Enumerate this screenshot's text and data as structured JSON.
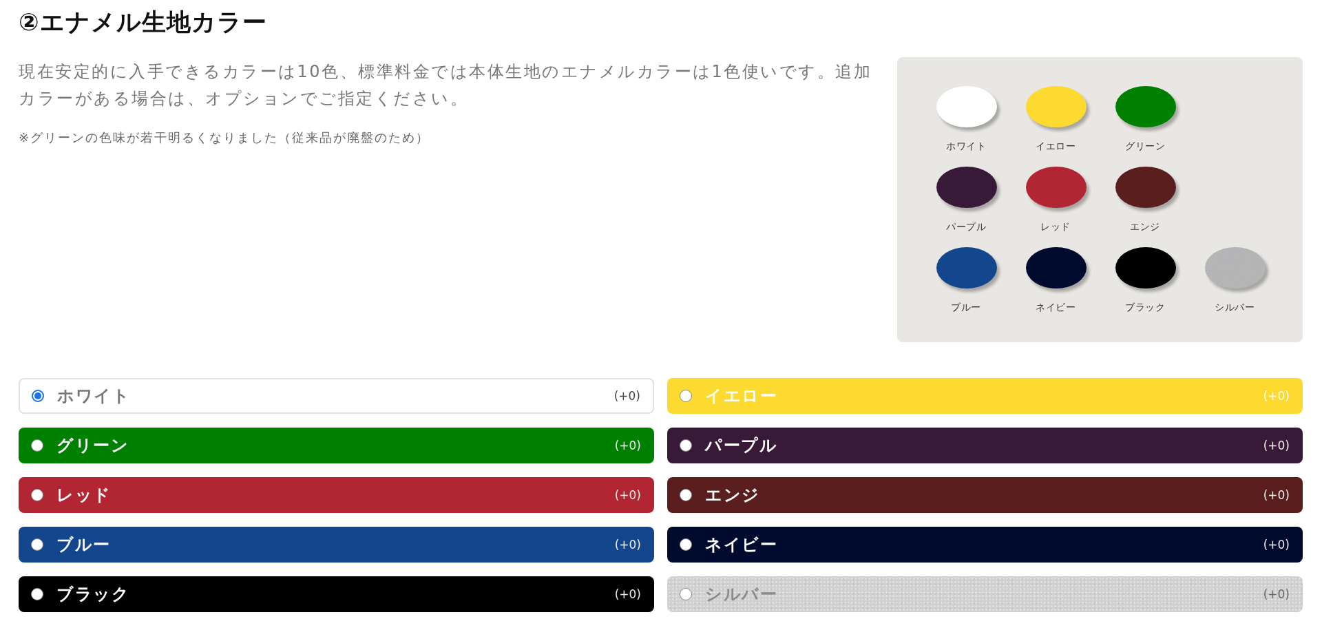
{
  "section": {
    "title": "②エナメル生地カラー",
    "description": "現在安定的に入手できるカラーは10色、標準料金では本体生地のエナメルカラーは1色使いです。追加カラーがある場合は、オプションでご指定ください。",
    "note": "※グリーンの色味が若干明るくなりました（従来品が廃盤のため）"
  },
  "swatch_panel": {
    "rows": [
      {
        "swatches": [
          {
            "label": "ホワイト",
            "color": "#ffffff",
            "kind": "solid"
          },
          {
            "label": "イエロー",
            "color": "#fdda2f",
            "kind": "solid"
          },
          {
            "label": "グリーン",
            "color": "#008000",
            "kind": "solid"
          }
        ]
      },
      {
        "swatches": [
          {
            "label": "パープル",
            "color": "#381a38",
            "kind": "solid"
          },
          {
            "label": "レッド",
            "color": "#b12632",
            "kind": "solid"
          },
          {
            "label": "エンジ",
            "color": "#5a1e1e",
            "kind": "solid"
          }
        ]
      },
      {
        "swatches": [
          {
            "label": "ブルー",
            "color": "#13468c",
            "kind": "solid"
          },
          {
            "label": "ネイビー",
            "color": "#000a2e",
            "kind": "solid"
          },
          {
            "label": "ブラック",
            "color": "#000000",
            "kind": "solid"
          },
          {
            "label": "シルバー",
            "color": "#b4b4b6",
            "kind": "metallic"
          }
        ]
      }
    ]
  },
  "options": [
    {
      "label": "ホワイト",
      "price": "(+0)",
      "selected": true,
      "color": "#ffffff",
      "kind": "plain"
    },
    {
      "label": "イエロー",
      "price": "(+0)",
      "selected": false,
      "color": "#fdda2f",
      "kind": "solid"
    },
    {
      "label": "グリーン",
      "price": "(+0)",
      "selected": false,
      "color": "#008000",
      "kind": "solid"
    },
    {
      "label": "パープル",
      "price": "(+0)",
      "selected": false,
      "color": "#381a38",
      "kind": "solid"
    },
    {
      "label": "レッド",
      "price": "(+0)",
      "selected": false,
      "color": "#b12632",
      "kind": "solid"
    },
    {
      "label": "エンジ",
      "price": "(+0)",
      "selected": false,
      "color": "#5a1e1e",
      "kind": "solid"
    },
    {
      "label": "ブルー",
      "price": "(+0)",
      "selected": false,
      "color": "#13468c",
      "kind": "solid"
    },
    {
      "label": "ネイビー",
      "price": "(+0)",
      "selected": false,
      "color": "#000a2e",
      "kind": "solid"
    },
    {
      "label": "ブラック",
      "price": "(+0)",
      "selected": false,
      "color": "#000000",
      "kind": "solid"
    },
    {
      "label": "シルバー",
      "price": "(+0)",
      "selected": false,
      "color": "#d0d0d0",
      "kind": "metallic"
    }
  ]
}
